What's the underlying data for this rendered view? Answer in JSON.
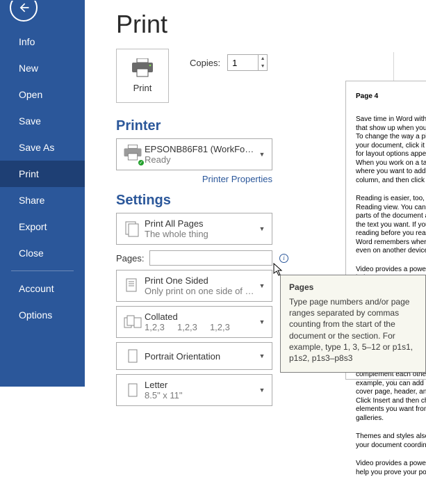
{
  "sidebar": {
    "items": [
      {
        "label": "Info"
      },
      {
        "label": "New"
      },
      {
        "label": "Open"
      },
      {
        "label": "Save"
      },
      {
        "label": "Save As"
      },
      {
        "label": "Print"
      },
      {
        "label": "Share"
      },
      {
        "label": "Export"
      },
      {
        "label": "Close"
      }
    ],
    "bottom": [
      {
        "label": "Account"
      },
      {
        "label": "Options"
      }
    ]
  },
  "header": {
    "title": "Print"
  },
  "printControls": {
    "printBtn": "Print",
    "copiesLabel": "Copies:",
    "copiesValue": "1"
  },
  "printerSection": {
    "heading": "Printer",
    "name": "EPSONB86F81 (WorkForce 8...",
    "status": "Ready",
    "propertiesLink": "Printer Properties"
  },
  "settingsSection": {
    "heading": "Settings",
    "scope": {
      "title": "Print All Pages",
      "sub": "The whole thing"
    },
    "pagesLabel": "Pages:",
    "pagesValue": "",
    "sided": {
      "title": "Print One Sided",
      "sub": "Only print on one side of th..."
    },
    "collate": {
      "title": "Collated",
      "sub": "1,2,3     1,2,3     1,2,3"
    },
    "orientation": {
      "title": "Portrait Orientation",
      "sub": ""
    },
    "paper": {
      "title": "Letter",
      "sub": "8.5\" x 11\""
    }
  },
  "tooltip": {
    "title": "Pages",
    "body": "Type page numbers and/or page ranges separated by commas counting from the start of the document or the section. For example, type 1, 3, 5–12 or p1s1, p1s2, p1s3–p8s3"
  },
  "preview": {
    "pageLabel": "Page 4",
    "p1": "Save time in Word with new buttons that show up when you double click. To change the way a picture fits in your document, click it and a button for layout options appears next to it. When you work on a table, click where you want to add a row or a column, and then click the plus sign.",
    "p2": "Reading is easier, too, in the new Reading view. You can collapse parts of the document and focus on the text you want. If you need to stop reading before you reach the end, Word remembers where you left off - even on another device.",
    "p3": "Video provides a powerful way to help you prove your point. When you click Online Video, you can paste in the embed code for the video you want to add. You can also type a keyword to search online for the video that best fits your document.",
    "p4": "To make your document look professionally produced, Word provides header, footer, cover page, and text box designs that complement each other. For example, you can add a matching cover page, header, and sidebar. Click Insert and then choose the elements you want from the different galleries.",
    "p5": "Themes and styles also help keep your document coordinated.",
    "p6": "Video provides a powerful way to help you prove your point."
  }
}
